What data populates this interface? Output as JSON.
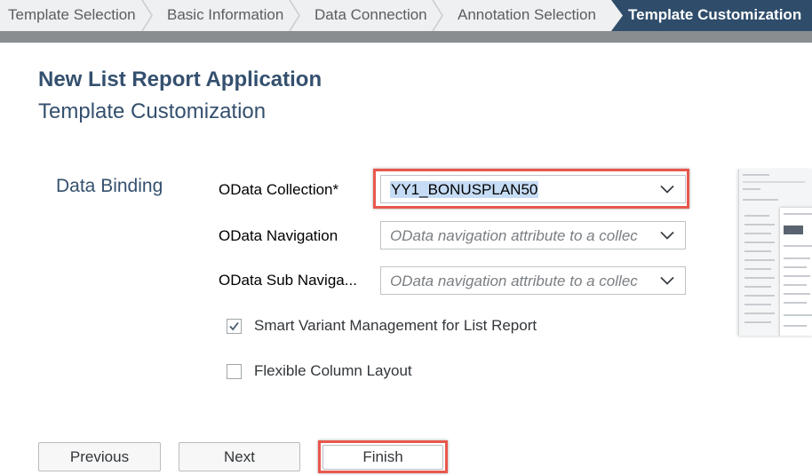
{
  "wizard": {
    "steps": [
      {
        "label": "Template Selection"
      },
      {
        "label": "Basic Information"
      },
      {
        "label": "Data Connection"
      },
      {
        "label": "Annotation Selection"
      },
      {
        "label": "Template Customization"
      }
    ],
    "active_step": "Template Customization"
  },
  "header": {
    "app_title": "New List Report Application",
    "page_subtitle": "Template Customization"
  },
  "data_binding": {
    "section_title": "Data Binding",
    "odata_collection": {
      "label": "OData Collection*",
      "value": "YY1_BONUSPLAN50"
    },
    "odata_navigation": {
      "label": "OData Navigation",
      "placeholder": "OData navigation attribute to a collec"
    },
    "odata_sub_navigation": {
      "label": "OData Sub Naviga...",
      "placeholder": "OData navigation attribute to a collec"
    }
  },
  "options": {
    "smart_variant": {
      "label": "Smart Variant Management for List Report",
      "checked": true
    },
    "flexible_column": {
      "label": "Flexible Column Layout",
      "checked": false
    }
  },
  "buttons": {
    "previous": "Previous",
    "next": "Next",
    "finish": "Finish"
  },
  "colors": {
    "active_step_bg": "#2f4d6b",
    "title_color": "#34506e",
    "highlight_border": "#e8574d"
  }
}
